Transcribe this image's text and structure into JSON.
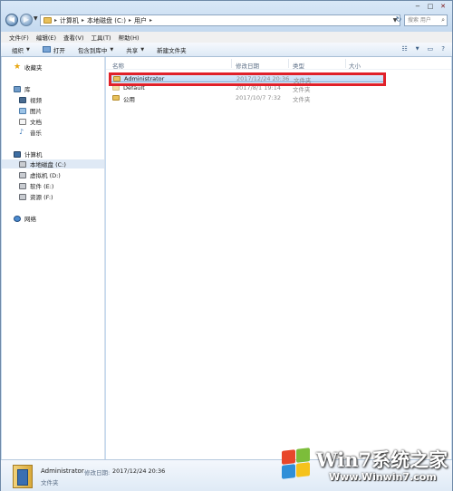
{
  "address_bar": {
    "breadcrumbs": [
      "计算机",
      "本地磁盘 (C:)",
      "用户"
    ],
    "search_placeholder": "搜索 用户"
  },
  "window_controls": [
    "−",
    "□",
    "✕"
  ],
  "menu": [
    "文件(F)",
    "编辑(E)",
    "查看(V)",
    "工具(T)",
    "帮助(H)"
  ],
  "toolbar": {
    "organize": "组织",
    "open": "打开",
    "include_in_library": "包含到库中",
    "share": "共享",
    "new_folder": "新建文件夹"
  },
  "nav_pane": {
    "favorites": "收藏夹",
    "libraries": "库",
    "library_items": [
      "视频",
      "图片",
      "文档",
      "音乐"
    ],
    "computer": "计算机",
    "drives": [
      "本地磁盘 (C:)",
      "虚拟机 (D:)",
      "软件 (E:)",
      "资源 (F:)"
    ],
    "network": "网络"
  },
  "columns": {
    "name": "名称",
    "date": "修改日期",
    "type": "类型",
    "size": "大小"
  },
  "files": [
    {
      "name": "Administrator",
      "date": "2017/12/24 20:36",
      "type": "文件夹"
    },
    {
      "name": "Default",
      "date": "2017/8/1 19:14",
      "type": "文件夹"
    },
    {
      "name": "公用",
      "date": "2017/10/7 7:32",
      "type": "文件夹"
    }
  ],
  "details": {
    "name": "Administrator",
    "date_label": "修改日期:",
    "date": "2017/12/24 20:36",
    "type": "文件夹"
  },
  "watermark": {
    "title": "Win7系统之家",
    "url": "Www.Winwin7.com"
  },
  "colors": {
    "highlight": "#e0212a",
    "selection": "#cfe3f8"
  }
}
